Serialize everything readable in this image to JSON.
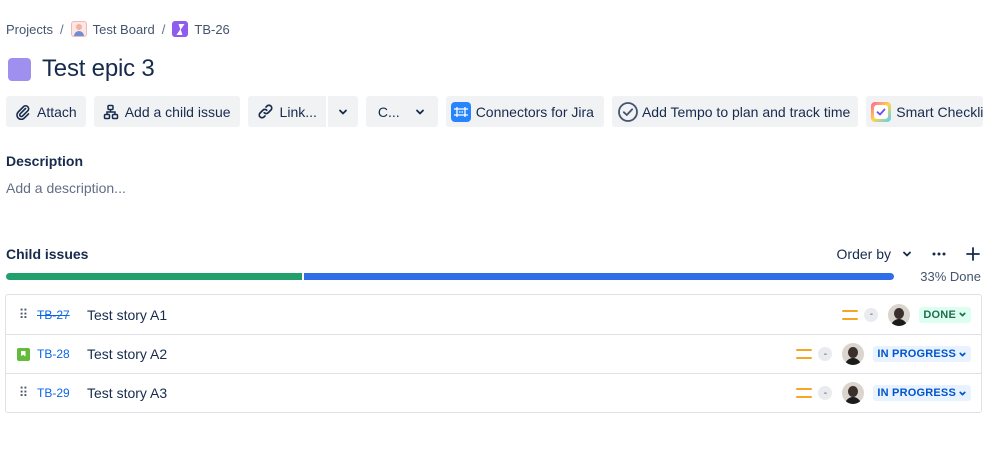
{
  "breadcrumb": {
    "projects": "Projects",
    "separator": "/",
    "board": "Test Board",
    "issue_key": "TB-26"
  },
  "title": "Test epic 3",
  "toolbar": {
    "attach": "Attach",
    "add_child": "Add a child issue",
    "link": "Link...",
    "create_short": "C...",
    "connectors": "Connectors for Jira",
    "tempo": "Add Tempo to plan and track time",
    "smart_checklist": "Smart Checkli"
  },
  "description": {
    "label": "Description",
    "placeholder": "Add a description..."
  },
  "child_issues": {
    "title": "Child issues",
    "order_by": "Order by",
    "progress_label": "33% Done",
    "progress_fraction": 0.333,
    "issues": [
      {
        "key": "TB-27",
        "summary": "Test story A1",
        "estimate": "-",
        "status": "DONE",
        "done": true
      },
      {
        "key": "TB-28",
        "summary": "Test story A2",
        "estimate": "-",
        "status": "IN PROGRESS",
        "done": false
      },
      {
        "key": "TB-29",
        "summary": "Test story A3",
        "estimate": "-",
        "status": "IN PROGRESS",
        "done": false
      }
    ]
  },
  "colors": {
    "epic": "#9f8fef",
    "progress_done": "#22a06b",
    "progress_rest": "#2f6ee8",
    "link": "#0c66e4",
    "priority_medium": "#f5a623",
    "story": "#63ba3c"
  },
  "icons": {
    "attach": "paperclip-icon",
    "add_child": "hierarchy-icon",
    "link": "link-icon",
    "dropdown": "chevron-down-icon",
    "connectors": "connectors-app-icon",
    "tempo": "check-circle-icon",
    "smart_checklist": "checklist-app-icon",
    "more": "more-icon",
    "add": "plus-icon",
    "drag": "drag-handle-icon",
    "story": "story-icon",
    "priority": "priority-medium-icon"
  }
}
